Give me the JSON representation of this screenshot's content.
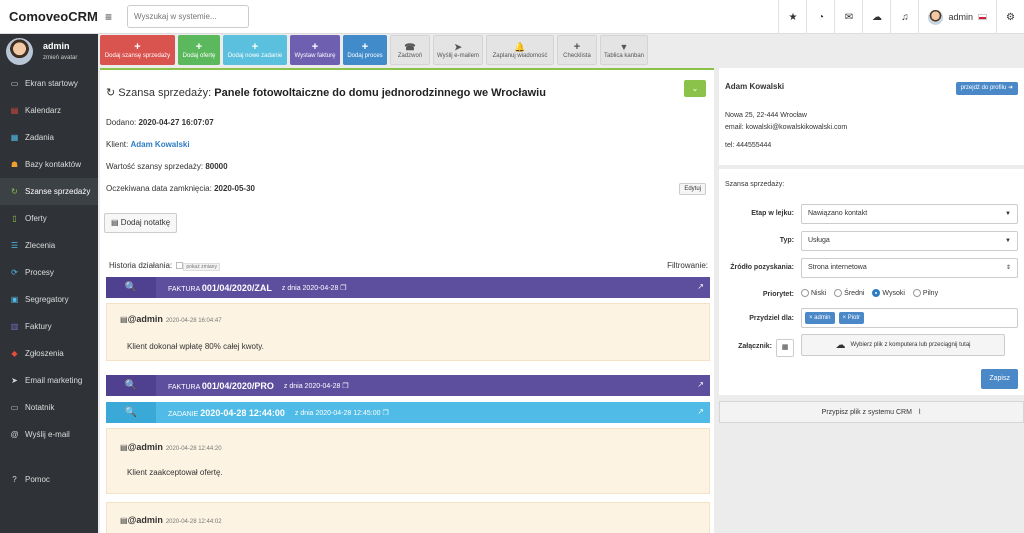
{
  "app": {
    "logo": "ComoveoCRM",
    "search_placeholder": "Wyszukaj w systemie..."
  },
  "topbar": {
    "icons": [
      "star-icon",
      "comments-icon",
      "envelope-icon",
      "cloud-icon",
      "bell-icon"
    ],
    "user_name": "admin",
    "settings_icon": "cogs-icon"
  },
  "sidebar": {
    "user_name": "admin",
    "user_sub": "zmień avatar",
    "items": [
      {
        "label": "Ekran startowy",
        "icon": "desktop-icon",
        "glyph": "▭",
        "color": "#d8d8d8"
      },
      {
        "label": "Kalendarz",
        "icon": "calendar-icon",
        "glyph": "▤",
        "color": "#e74c3c"
      },
      {
        "label": "Zadania",
        "icon": "tasks-icon",
        "glyph": "▦",
        "color": "#4fbbe6"
      },
      {
        "label": "Bazy kontaktów",
        "icon": "users-icon",
        "glyph": "☗",
        "color": "#f0a030"
      },
      {
        "label": "Szanse sprzedaży",
        "icon": "refresh-icon",
        "glyph": "↻",
        "color": "#8bc34a"
      },
      {
        "label": "Oferty",
        "icon": "file-icon",
        "glyph": "▯",
        "color": "#8bc34a"
      },
      {
        "label": "Zlecenia",
        "icon": "list-icon",
        "glyph": "☰",
        "color": "#4fbbe6"
      },
      {
        "label": "Procesy",
        "icon": "sync-icon",
        "glyph": "⟳",
        "color": "#4fbbe6"
      },
      {
        "label": "Segregatory",
        "icon": "folder-icon",
        "glyph": "▣",
        "color": "#4fbbe6"
      },
      {
        "label": "Faktury",
        "icon": "invoice-icon",
        "glyph": "▥",
        "color": "#7b68c8"
      },
      {
        "label": "Zgłoszenia",
        "icon": "ticket-icon",
        "glyph": "◆",
        "color": "#e74c3c"
      },
      {
        "label": "Email marketing",
        "icon": "send-icon",
        "glyph": "➤",
        "color": "#d8d8d8"
      },
      {
        "label": "Notatnik",
        "icon": "note-icon",
        "glyph": "▭",
        "color": "#d8d8d8"
      },
      {
        "label": "Wyślij e-mail",
        "icon": "mail-icon",
        "glyph": "@",
        "color": "#d8d8d8"
      }
    ],
    "help": {
      "label": "Pomoc",
      "icon": "help-icon",
      "glyph": "?"
    }
  },
  "toolbar": {
    "buttons": [
      {
        "label": "Dodaj szansę sprzedaży",
        "color": "#d9534f",
        "style": "color",
        "glyph": "+",
        "icon": "plus-icon",
        "width": 75
      },
      {
        "label": "Dodaj ofertę",
        "color": "#5cb85c",
        "style": "color",
        "glyph": "+",
        "icon": "plus-icon",
        "width": 42
      },
      {
        "label": "Dodaj nowe zadanie",
        "color": "#5bc0de",
        "style": "color",
        "glyph": "+",
        "icon": "plus-icon",
        "width": 64
      },
      {
        "label": "Wystaw fakturę",
        "color": "#6f5fb0",
        "style": "color",
        "glyph": "+",
        "icon": "plus-icon",
        "width": 50
      },
      {
        "label": "Dodaj proces",
        "color": "#428bca",
        "style": "color",
        "glyph": "+",
        "icon": "plus-icon",
        "width": 44
      },
      {
        "label": "Zadzwoń",
        "style": "gray",
        "glyph": "☎",
        "icon": "phone-icon",
        "width": 40
      },
      {
        "label": "Wyślij e-mailem",
        "style": "gray",
        "glyph": "➤",
        "icon": "send-icon",
        "width": 50
      },
      {
        "label": "Zaplanuj wiadomość",
        "style": "gray",
        "glyph": "🔔",
        "icon": "bell-icon",
        "width": 68
      },
      {
        "label": "Checklista",
        "style": "gray",
        "glyph": "+",
        "icon": "plus-icon",
        "width": 40
      },
      {
        "label": "Tablica kanban",
        "style": "gray",
        "glyph": "▼",
        "icon": "filter-icon",
        "width": 48
      }
    ]
  },
  "main": {
    "title_prefix": "Szansa sprzedaży:",
    "title": "Panele fotowoltaiczne do domu jednorodzinnego we Wrocławiu",
    "added_label": "Dodano:",
    "added_value": "2020-04-27 16:07:07",
    "client_label": "Klient:",
    "client_value": "Adam Kowalski",
    "value_label": "Wartość szansy sprzedaży:",
    "value_value": "80000",
    "close_label": "Oczekiwana data zamknięcia:",
    "close_value": "2020-05-30",
    "edit_btn": "Edytuj",
    "add_note_btn": "Dodaj notatkę",
    "history_label": "Historia działania:",
    "show_changes": "pokaż zmiany",
    "filter_label": "Filtrowanie:",
    "history": [
      {
        "type": "FAKTURA",
        "number": "001/04/2020/ZAL",
        "date": "z dnia 2020-04-28",
        "color": "purple"
      },
      {
        "type": "FAKTURA",
        "number": "001/04/2020/PRO",
        "date": "z dnia 2020-04-28",
        "color": "purple"
      },
      {
        "type": "ZADANIE",
        "number": "2020-04-28 12:44:00",
        "date": "z dnia 2020-04-28 12:45:00",
        "color": "cyan"
      }
    ],
    "notes": [
      {
        "author": "@admin",
        "time": "2020-04-28 16:04:47",
        "text": "Klient dokonał wpłatę 80% całej kwoty."
      },
      {
        "author": "@admin",
        "time": "2020-04-28 12:44:20",
        "text": "Klient zaakceptował ofertę."
      },
      {
        "author": "@admin",
        "time": "2020-04-28 12:44:02",
        "text": ""
      }
    ]
  },
  "client_card": {
    "name": "Adam Kowalski",
    "profile_btn": "przejdź do profilu",
    "address": "Nowa 25, 22-444 Wrocław",
    "email": "email: kowalski@kowalskikowalski.com",
    "phone": "tel: 444555444"
  },
  "form": {
    "title": "Szansa sprzedaży:",
    "stage_label": "Etap w lejku:",
    "stage_value": "Nawiązano kontakt",
    "type_label": "Typ:",
    "type_value": "Usługa",
    "source_label": "Źródło pozyskania:",
    "source_value": "Strona internetowa",
    "priority_label": "Priorytet:",
    "priority_options": [
      "Niski",
      "Średni",
      "Wysoki",
      "Pilny"
    ],
    "priority_selected": "Wysoki",
    "assign_label": "Przydziel dla:",
    "assign_tags": [
      "× admin",
      "× Piotr"
    ],
    "attach_label": "Załącznik:",
    "upload_btn": "Wybierz plik z komputera  lub  przeciągnij tutaj",
    "save_btn": "Zapisz"
  },
  "assign_file_btn": "Przypisz plik z systemu CRM"
}
